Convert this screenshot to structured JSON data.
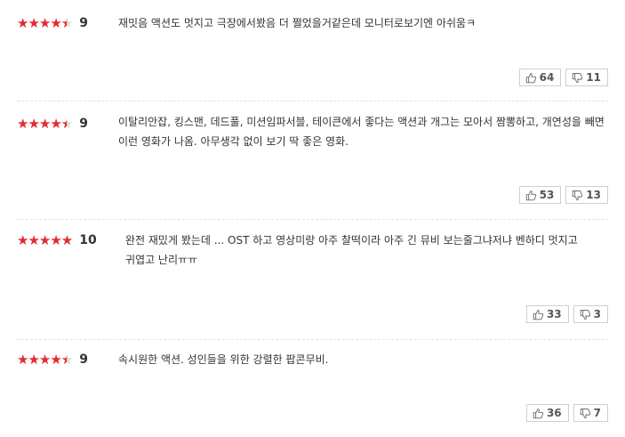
{
  "reviews": [
    {
      "rating": 9,
      "rating_fraction": 0.9,
      "text": "재밋음 액션도 멋지고 극장에서봤음 더 쩔었을거같은데 모니터로보기엔 아쉬움ㅋ",
      "likes": "64",
      "dislikes": "11"
    },
    {
      "rating": 9,
      "rating_fraction": 0.9,
      "text": "이탈리안잡, 킹스맨, 데드풀, 미션임파서블, 테이큰에서 좋다는 액션과 개그는 모아서 짬뽕하고, 개연성을 빼면 이런 영화가 나옴. 아무생각 없이 보기 딱 좋은 영화.",
      "likes": "53",
      "dislikes": "13"
    },
    {
      "rating": 10,
      "rating_fraction": 1.0,
      "text": "완전 재밌게 봤는데 ... OST 하고 영상미랑 아주 찰떡이라 아주 긴 뮤비 보는줄그냐저냐 벤하디 멋지고 귀엽고 난리ㅠㅠ",
      "likes": "33",
      "dislikes": "3"
    },
    {
      "rating": 9,
      "rating_fraction": 0.9,
      "text": "속시원한 액션. 성인들을 위한 강렬한 팝콘무비.",
      "likes": "36",
      "dislikes": "7"
    }
  ],
  "icons": {
    "star": "star-icon",
    "like": "thumbs-up-icon",
    "dislike": "thumbs-down-icon"
  },
  "colors": {
    "star_filled": "#e52a2f",
    "star_empty": "#dadada",
    "text": "#333333",
    "button_border": "#cfcfcf"
  }
}
